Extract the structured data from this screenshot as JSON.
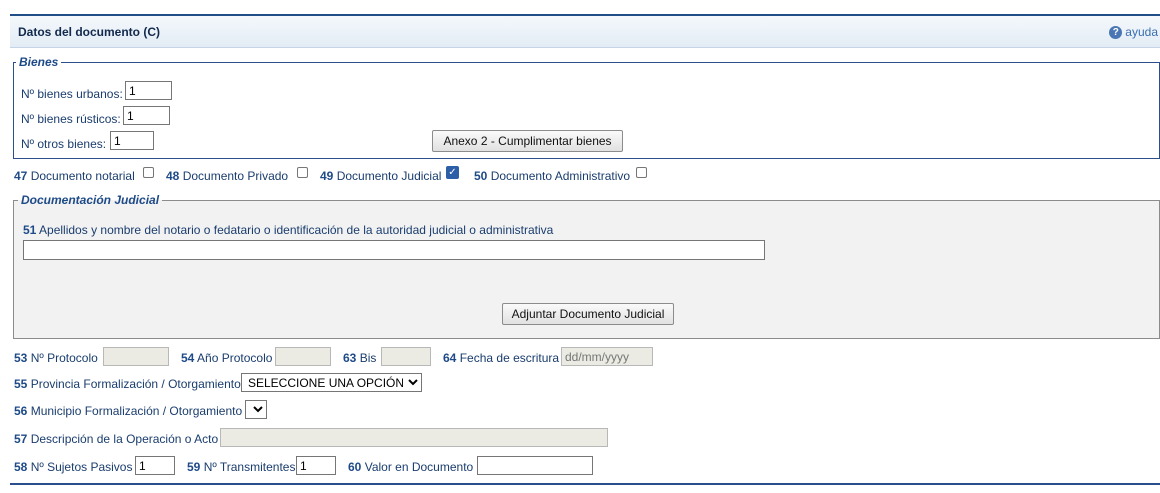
{
  "header": {
    "title": "Datos del documento (C)",
    "help_label": "ayuda",
    "help_icon": "question-circle-icon"
  },
  "bienes": {
    "legend": "Bienes",
    "urbanos_label": "Nº bienes urbanos:",
    "urbanos_value": "1",
    "rusticos_label": "Nº bienes rústicos:",
    "rusticos_value": "1",
    "otros_label": "Nº otros bienes:",
    "otros_value": "1",
    "anexo_button": "Anexo 2 - Cumplimentar bienes"
  },
  "doc_types": [
    {
      "num": "47",
      "label": "Documento notarial",
      "checked": false
    },
    {
      "num": "48",
      "label": "Documento Privado",
      "checked": false
    },
    {
      "num": "49",
      "label": "Documento Judicial",
      "checked": true
    },
    {
      "num": "50",
      "label": "Documento Administrativo",
      "checked": false
    }
  ],
  "judicial": {
    "legend": "Documentación Judicial",
    "field51_num": "51",
    "field51_label": "Apellidos y nombre del notario o fedatario o identificación de la autoridad judicial o administrativa",
    "field51_value": "",
    "adjuntar_button": "Adjuntar Documento Judicial"
  },
  "fields": {
    "f53_num": "53",
    "f53_label": "Nº Protocolo",
    "f53_value": "",
    "f54_num": "54",
    "f54_label": "Año Protocolo",
    "f54_value": "",
    "f63_num": "63",
    "f63_label": "Bis",
    "f63_value": "",
    "f64_num": "64",
    "f64_label": "Fecha de escritura",
    "f64_placeholder": "dd/mm/yyyy",
    "f55_num": "55",
    "f55_label": "Provincia Formalización / Otorgamiento",
    "f55_selected": "SELECCIONE UNA OPCIÓN",
    "f56_num": "56",
    "f56_label": "Municipio Formalización / Otorgamiento",
    "f56_selected": "",
    "f57_num": "57",
    "f57_label": "Descripción de la Operación o Acto",
    "f57_value": "",
    "f58_num": "58",
    "f58_label": "Nº Sujetos Pasivos",
    "f58_value": "1",
    "f59_num": "59",
    "f59_label": "Nº Transmitentes",
    "f59_value": "1",
    "f60_num": "60",
    "f60_label": "Valor en Documento",
    "f60_value": ""
  }
}
